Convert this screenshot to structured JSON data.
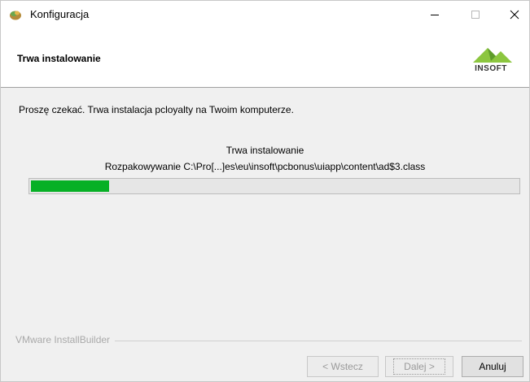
{
  "window": {
    "title": "Konfiguracja"
  },
  "header": {
    "title": "Trwa instalowanie",
    "logo_text": "INSOFT"
  },
  "main": {
    "message": "Proszę czekać. Trwa instalacja pcloyalty na Twoim komputerze.",
    "status_title": "Trwa instalowanie",
    "status_detail": "Rozpakowywanie C:\\Pro[...]es\\eu\\insoft\\pcbonus\\uiapp\\content\\ad$3.class",
    "progress": 0.16
  },
  "footer": {
    "brand": "VMware InstallBuilder",
    "back_label": "< Wstecz",
    "next_label": "Dalej >",
    "cancel_label": "Anuluj"
  },
  "colors": {
    "progress": "#06b025",
    "logo_green": "#8cc63f"
  },
  "icons": {
    "app": "installer-icon",
    "minimize": "minimize-icon",
    "maximize": "maximize-icon",
    "close": "close-icon"
  }
}
